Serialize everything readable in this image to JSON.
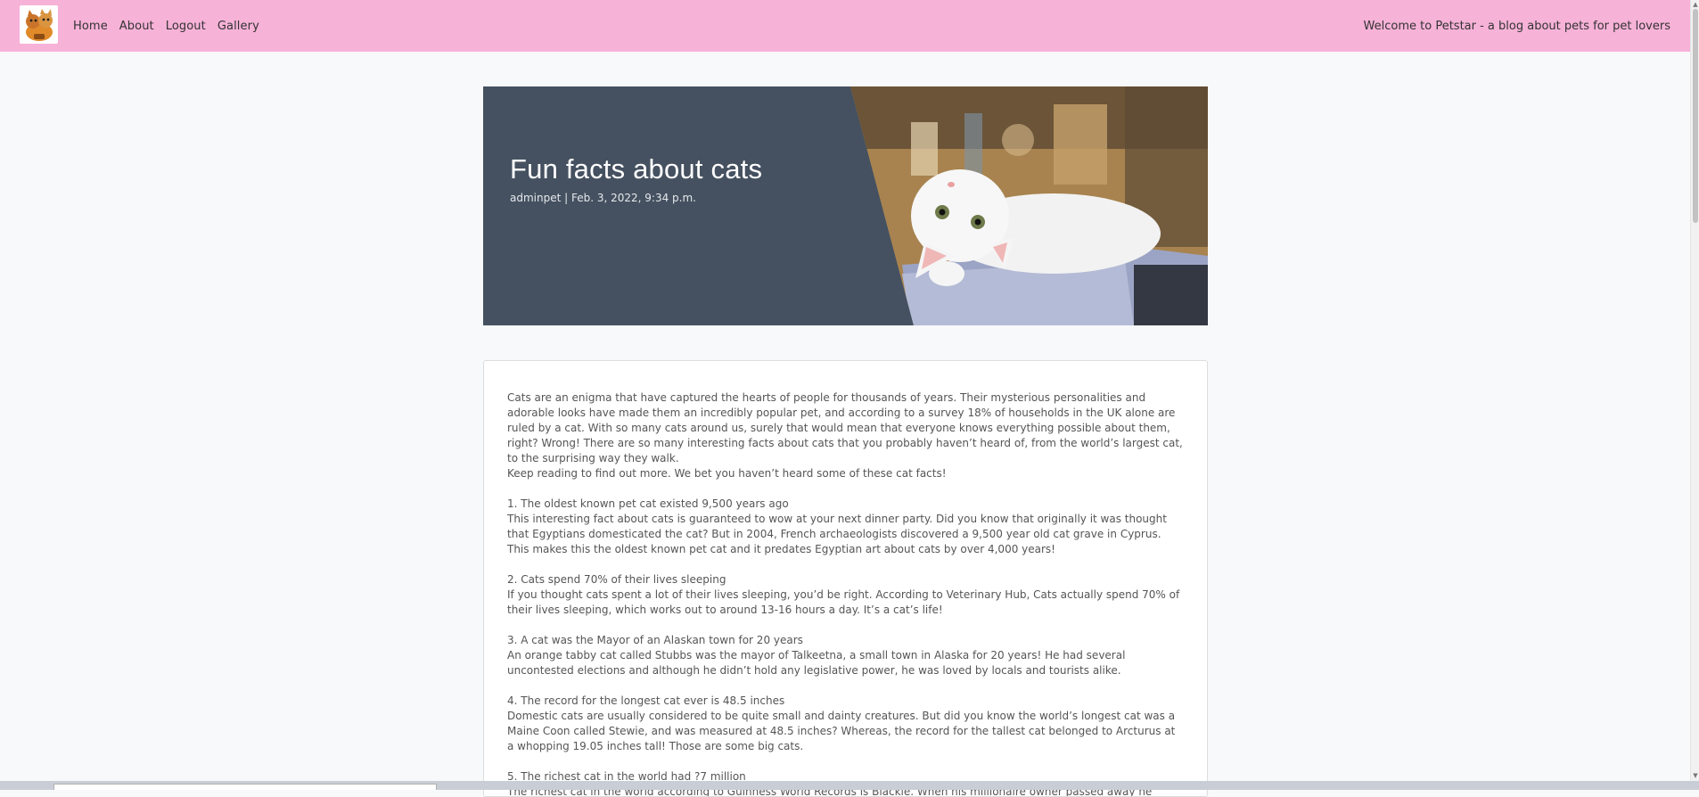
{
  "nav": {
    "logo_icon": "cat-dog-logo-icon",
    "links": [
      "Home",
      "About",
      "Logout",
      "Gallery"
    ],
    "welcome": "Welcome to Petstar - a blog about pets for pet lovers"
  },
  "hero": {
    "title": "Fun facts about cats",
    "meta": "adminpet | Feb. 3, 2022, 9:34 p.m.",
    "image_icon": "white-kitten-photo"
  },
  "post": {
    "intro": "Cats are an enigma that have captured the hearts of people for thousands of years. Their mysterious personalities and adorable looks have made them an incredibly popular pet, and according to a survey 18% of households in the UK alone are ruled by a cat. With so many cats around us, surely that would mean that everyone knows everything possible about them, right? Wrong! There are so many interesting facts about cats that you probably haven’t heard of, from the world’s largest cat, to the surprising way they walk.",
    "intro2": "Keep reading to find out more. We bet you haven’t heard some of these cat facts!",
    "facts": [
      {
        "heading": "1. The oldest known pet cat existed 9,500 years ago",
        "body": "This interesting fact about cats is guaranteed to wow at your next dinner party. Did you know that originally it was thought that Egyptians domesticated the cat? But in 2004, French archaeologists discovered a 9,500 year old cat grave in Cyprus. This makes this the oldest known pet cat and it predates Egyptian art about cats by over 4,000 years!"
      },
      {
        "heading": "2. Cats spend 70% of their lives sleeping",
        "body": "If you thought cats spent a lot of their lives sleeping, you’d be right. According to Veterinary Hub, Cats actually spend 70% of their lives sleeping, which works out to around 13-16 hours a day. It’s a cat’s life!"
      },
      {
        "heading": "3. A cat was the Mayor of an Alaskan town for 20 years",
        "body": "An orange tabby cat called Stubbs was the mayor of Talkeetna, a small town in Alaska for 20 years! He had several uncontested elections and although he didn’t hold any legislative power, he was loved by locals and tourists alike."
      },
      {
        "heading": "4. The record for the longest cat ever is 48.5 inches",
        "body": "Domestic cats are usually considered to be quite small and dainty creatures. But did you know the world’s longest cat was a Maine Coon called Stewie, and was measured at 48.5 inches? Whereas, the record for the tallest cat belonged to Arcturus at a whopping 19.05 inches tall! Those are some big cats."
      },
      {
        "heading": "5. The richest cat in the world had ?7 million",
        "body": "The richest cat in the world according to Guinness World Records is Blackie. When his millionaire owner passed away he refused to"
      }
    ]
  }
}
